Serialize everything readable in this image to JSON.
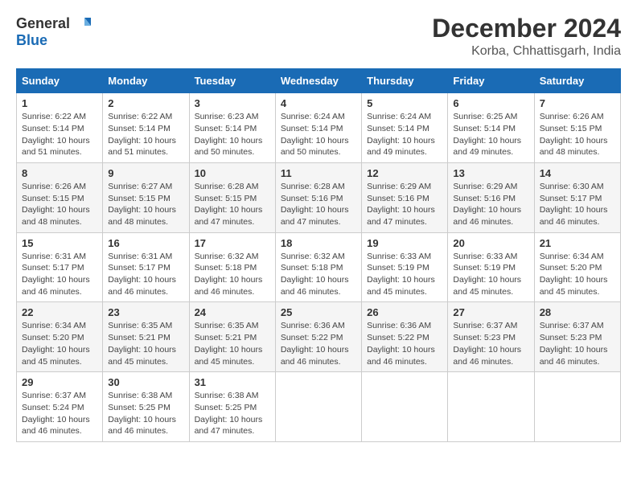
{
  "header": {
    "logo_general": "General",
    "logo_blue": "Blue",
    "month": "December 2024",
    "location": "Korba, Chhattisgarh, India"
  },
  "weekdays": [
    "Sunday",
    "Monday",
    "Tuesday",
    "Wednesday",
    "Thursday",
    "Friday",
    "Saturday"
  ],
  "weeks": [
    [
      {
        "day": 1,
        "sunrise": "6:22 AM",
        "sunset": "5:14 PM",
        "daylight": "10 hours and 51 minutes."
      },
      {
        "day": 2,
        "sunrise": "6:22 AM",
        "sunset": "5:14 PM",
        "daylight": "10 hours and 51 minutes."
      },
      {
        "day": 3,
        "sunrise": "6:23 AM",
        "sunset": "5:14 PM",
        "daylight": "10 hours and 50 minutes."
      },
      {
        "day": 4,
        "sunrise": "6:24 AM",
        "sunset": "5:14 PM",
        "daylight": "10 hours and 50 minutes."
      },
      {
        "day": 5,
        "sunrise": "6:24 AM",
        "sunset": "5:14 PM",
        "daylight": "10 hours and 49 minutes."
      },
      {
        "day": 6,
        "sunrise": "6:25 AM",
        "sunset": "5:14 PM",
        "daylight": "10 hours and 49 minutes."
      },
      {
        "day": 7,
        "sunrise": "6:26 AM",
        "sunset": "5:15 PM",
        "daylight": "10 hours and 48 minutes."
      }
    ],
    [
      {
        "day": 8,
        "sunrise": "6:26 AM",
        "sunset": "5:15 PM",
        "daylight": "10 hours and 48 minutes."
      },
      {
        "day": 9,
        "sunrise": "6:27 AM",
        "sunset": "5:15 PM",
        "daylight": "10 hours and 48 minutes."
      },
      {
        "day": 10,
        "sunrise": "6:28 AM",
        "sunset": "5:15 PM",
        "daylight": "10 hours and 47 minutes."
      },
      {
        "day": 11,
        "sunrise": "6:28 AM",
        "sunset": "5:16 PM",
        "daylight": "10 hours and 47 minutes."
      },
      {
        "day": 12,
        "sunrise": "6:29 AM",
        "sunset": "5:16 PM",
        "daylight": "10 hours and 47 minutes."
      },
      {
        "day": 13,
        "sunrise": "6:29 AM",
        "sunset": "5:16 PM",
        "daylight": "10 hours and 46 minutes."
      },
      {
        "day": 14,
        "sunrise": "6:30 AM",
        "sunset": "5:17 PM",
        "daylight": "10 hours and 46 minutes."
      }
    ],
    [
      {
        "day": 15,
        "sunrise": "6:31 AM",
        "sunset": "5:17 PM",
        "daylight": "10 hours and 46 minutes."
      },
      {
        "day": 16,
        "sunrise": "6:31 AM",
        "sunset": "5:17 PM",
        "daylight": "10 hours and 46 minutes."
      },
      {
        "day": 17,
        "sunrise": "6:32 AM",
        "sunset": "5:18 PM",
        "daylight": "10 hours and 46 minutes."
      },
      {
        "day": 18,
        "sunrise": "6:32 AM",
        "sunset": "5:18 PM",
        "daylight": "10 hours and 46 minutes."
      },
      {
        "day": 19,
        "sunrise": "6:33 AM",
        "sunset": "5:19 PM",
        "daylight": "10 hours and 45 minutes."
      },
      {
        "day": 20,
        "sunrise": "6:33 AM",
        "sunset": "5:19 PM",
        "daylight": "10 hours and 45 minutes."
      },
      {
        "day": 21,
        "sunrise": "6:34 AM",
        "sunset": "5:20 PM",
        "daylight": "10 hours and 45 minutes."
      }
    ],
    [
      {
        "day": 22,
        "sunrise": "6:34 AM",
        "sunset": "5:20 PM",
        "daylight": "10 hours and 45 minutes."
      },
      {
        "day": 23,
        "sunrise": "6:35 AM",
        "sunset": "5:21 PM",
        "daylight": "10 hours and 45 minutes."
      },
      {
        "day": 24,
        "sunrise": "6:35 AM",
        "sunset": "5:21 PM",
        "daylight": "10 hours and 45 minutes."
      },
      {
        "day": 25,
        "sunrise": "6:36 AM",
        "sunset": "5:22 PM",
        "daylight": "10 hours and 46 minutes."
      },
      {
        "day": 26,
        "sunrise": "6:36 AM",
        "sunset": "5:22 PM",
        "daylight": "10 hours and 46 minutes."
      },
      {
        "day": 27,
        "sunrise": "6:37 AM",
        "sunset": "5:23 PM",
        "daylight": "10 hours and 46 minutes."
      },
      {
        "day": 28,
        "sunrise": "6:37 AM",
        "sunset": "5:23 PM",
        "daylight": "10 hours and 46 minutes."
      }
    ],
    [
      {
        "day": 29,
        "sunrise": "6:37 AM",
        "sunset": "5:24 PM",
        "daylight": "10 hours and 46 minutes."
      },
      {
        "day": 30,
        "sunrise": "6:38 AM",
        "sunset": "5:25 PM",
        "daylight": "10 hours and 46 minutes."
      },
      {
        "day": 31,
        "sunrise": "6:38 AM",
        "sunset": "5:25 PM",
        "daylight": "10 hours and 47 minutes."
      },
      null,
      null,
      null,
      null
    ]
  ]
}
